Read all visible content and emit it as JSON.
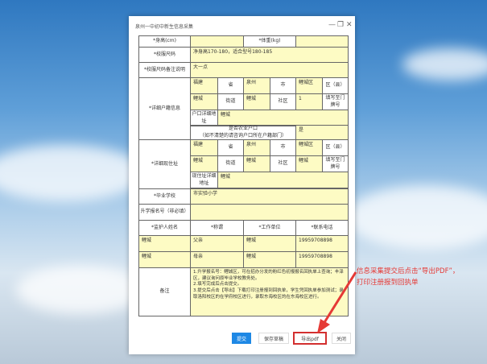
{
  "window": {
    "title": "泉州一中初中新生信息采集"
  },
  "form": {
    "height_label": "*身高(cm)",
    "weight_label": "*体重(kg)",
    "uniform_label": "*校服尺码",
    "uniform_value": "净身高170-180，适合型号180-185",
    "uniform_note_label": "*校服尺码备注说明",
    "uniform_note_value": "大一点",
    "hukou": {
      "label": "*详细户籍信息",
      "province": "福建",
      "province_unit": "省",
      "city": "泉州",
      "city_unit": "市",
      "district": "鲤城区",
      "district_unit": "区（县）",
      "street": "鲤城",
      "street_unit": "街道",
      "community": "鲤城",
      "community_unit": "社区",
      "doorplate": "1",
      "doorplate_unit": "填写至门牌号",
      "addr_label": "户口详细地址",
      "addr_value": "鲤城",
      "agri_label": "是否农业户口",
      "agri_hint": "（如不清楚的请咨询户口所在户籍部门）",
      "agri_value": "是"
    },
    "residence": {
      "label": "*详细现住址",
      "province": "福建",
      "province_unit": "省",
      "city": "泉州",
      "city_unit": "市",
      "district": "鲤城区",
      "district_unit": "区（县）",
      "street": "鲤城",
      "street_unit": "街道",
      "community": "鲤城",
      "community_unit": "社区",
      "doorplate": "鲤城",
      "doorplate_unit": "填写至门牌号",
      "addr_label": "现住址详细地址",
      "addr_value": "鲤城"
    },
    "school_label": "*毕业学校",
    "school_value": "市实验小学",
    "regno_label": "升学报名号（非必填）",
    "guardian_headers": [
      "*监护人姓名",
      "*称谓",
      "*工作单位",
      "*联系电话"
    ],
    "guardians": [
      [
        "鲤城",
        "父亲",
        "鲤城",
        "19959708898"
      ],
      [
        "鲤城",
        "母亲",
        "鲤城",
        "19959708898"
      ]
    ],
    "remarks_label": "备注",
    "remarks_value": "1.升学报名号：鲤城区，可在招办分发的粉红色初报报名回执单上查询；丰泽区，建议询问原毕业学校教务处。\n2.填写完成后点击提交。\n3.提交后点击【导出】下载打印注册报到回执单，学生凭回执单参加测试；录取洛阳校区的在学府校区进行，录取东海校区的在东海校区进行。"
  },
  "buttons": {
    "submit": "提交",
    "save_draft": "保存草稿",
    "export_pdf": "导出pdf",
    "close": "关闭"
  },
  "annotation": {
    "line1": "信息采集提交后点击“导出PDF”，",
    "line2": "打印注册报到回执单",
    "color": "#e53935"
  },
  "colors": {
    "primary": "#1e88e5",
    "field": "#fdfbc4"
  }
}
